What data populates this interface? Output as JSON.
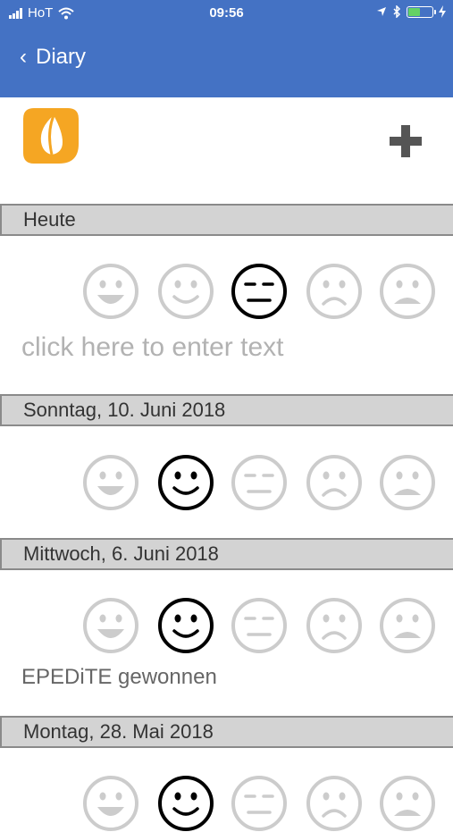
{
  "status_bar": {
    "carrier": "HoT",
    "time": "09:56",
    "battery_level": 0.5
  },
  "nav": {
    "back_label": "Diary"
  },
  "colors": {
    "nav_bg": "#4472c4",
    "header_bg": "#d3d3d3",
    "active": "#000000",
    "inactive": "#cccccc",
    "logo": "#f5a623"
  },
  "sections": [
    {
      "date": "Heute",
      "selected_mood": 2,
      "placeholder": "click here to enter text"
    },
    {
      "date": "Sonntag, 10. Juni 2018",
      "selected_mood": 1
    },
    {
      "date": "Mittwoch, 6. Juni 2018",
      "selected_mood": 1,
      "note": "EPEDiTE gewonnen"
    },
    {
      "date": "Montag, 28. Mai 2018",
      "selected_mood": 1
    }
  ],
  "moods": [
    "very-happy",
    "happy",
    "neutral",
    "sad",
    "very-sad"
  ]
}
